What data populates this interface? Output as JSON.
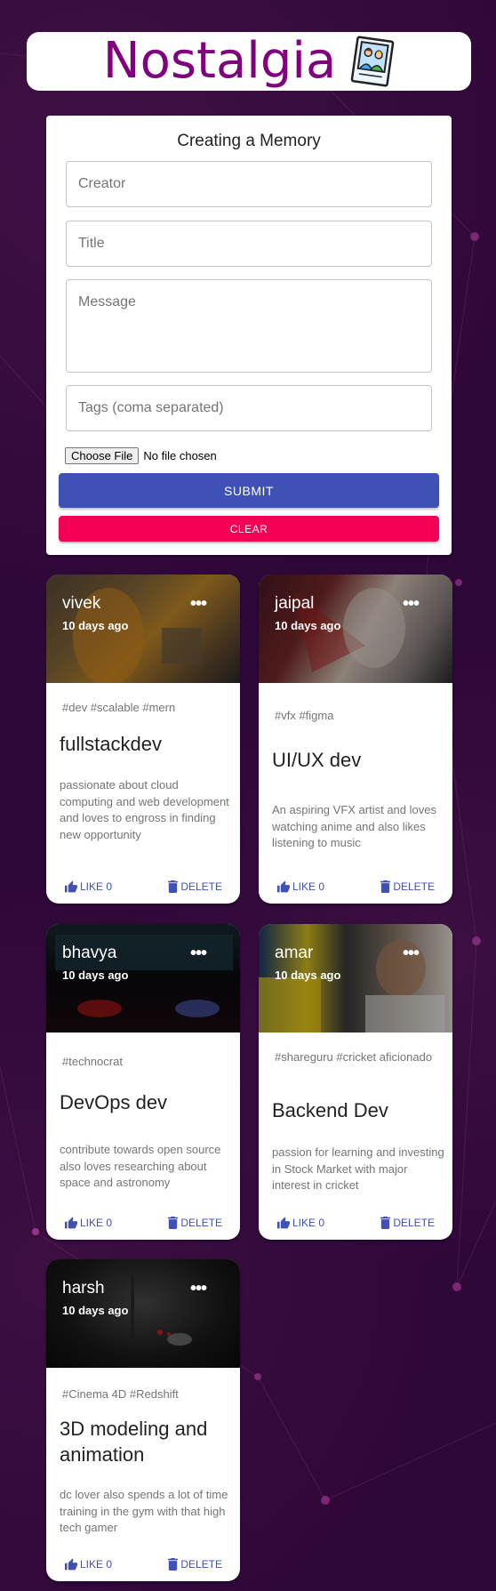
{
  "app": {
    "title": "Nostalgia",
    "logo_icon": "memories-photo-icon"
  },
  "form": {
    "heading": "Creating a Memory",
    "creator_placeholder": "Creator",
    "title_placeholder": "Title",
    "message_placeholder": "Message",
    "tags_placeholder": "Tags (coma separated)",
    "file_button": "Choose File",
    "file_status": "No file chosen",
    "submit_label": "SUBMIT",
    "clear_label": "CLEAR"
  },
  "colors": {
    "background": "#2e0838",
    "brand": "#800080",
    "primary": "#3f51b5",
    "secondary": "#f50057"
  },
  "posts": [
    {
      "creator": "vivek",
      "time": "10 days ago",
      "tags": "#dev #scalable #mern",
      "title": "fullstackdev",
      "message": "passionate about cloud computing and web development and loves to engross in finding new opportunity",
      "like_label": "LIKE 0",
      "delete_label": "DELETE"
    },
    {
      "creator": "jaipal",
      "time": "10 days ago",
      "tags": "#vfx #figma",
      "title": "UI/UX dev",
      "message": "An aspiring VFX artist and loves watching anime and also likes listening to music",
      "like_label": "LIKE 0",
      "delete_label": "DELETE"
    },
    {
      "creator": "bhavya",
      "time": "10 days ago",
      "tags": "#technocrat",
      "title": "DevOps dev",
      "message": "contribute towards open source also loves researching about space and astronomy",
      "like_label": "LIKE 0",
      "delete_label": "DELETE"
    },
    {
      "creator": "amar",
      "time": "10 days ago",
      "tags": "#shareguru #cricket aficionado",
      "title": "Backend Dev",
      "message": "passion for learning and investing in Stock Market with major interest in cricket",
      "like_label": "LIKE 0",
      "delete_label": "DELETE"
    },
    {
      "creator": "harsh",
      "time": "10 days ago",
      "tags": "#Cinema 4D #Redshift",
      "title": "3D modeling and animation",
      "message": "dc lover also spends a lot of time training in the gym with that high tech gamer",
      "like_label": "LIKE 0",
      "delete_label": "DELETE"
    }
  ]
}
